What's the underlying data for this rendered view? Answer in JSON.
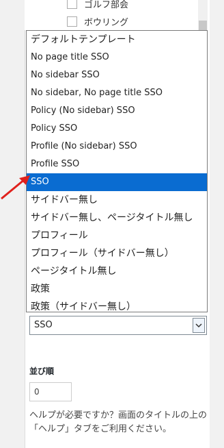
{
  "checklist": [
    {
      "label": "ゴルフ部会"
    },
    {
      "label": "ボウリング"
    }
  ],
  "dropdown": {
    "options": [
      {
        "label": "デフォルトテンプレート",
        "jp": true
      },
      {
        "label": "No page title SSO"
      },
      {
        "label": "No sidebar SSO"
      },
      {
        "label": "No sidebar, No page title SSO"
      },
      {
        "label": "Policy (No sidebar) SSO"
      },
      {
        "label": "Policy SSO"
      },
      {
        "label": "Profile (No sidebar) SSO"
      },
      {
        "label": "Profile SSO"
      },
      {
        "label": "SSO",
        "selected": true
      },
      {
        "label": "サイドバー無し",
        "jp": true
      },
      {
        "label": "サイドバー無し、ページタイトル無し",
        "jp": true
      },
      {
        "label": "プロフィール",
        "jp": true
      },
      {
        "label": "プロフィール（サイドバー無し）",
        "jp": true
      },
      {
        "label": "ページタイトル無し",
        "jp": true
      },
      {
        "label": "政策",
        "jp": true
      },
      {
        "label": "政策（サイドバー無し）",
        "jp": true
      }
    ]
  },
  "template_select": {
    "value": "SSO"
  },
  "order": {
    "label": "並び順",
    "value": "0"
  },
  "help_text": "ヘルプが必要ですか？画面のタイトルの上の「ヘルプ」タブをご利用ください。",
  "colors": {
    "selected_bg": "#0a6cd1",
    "annotation_arrow": "#e0201b"
  }
}
